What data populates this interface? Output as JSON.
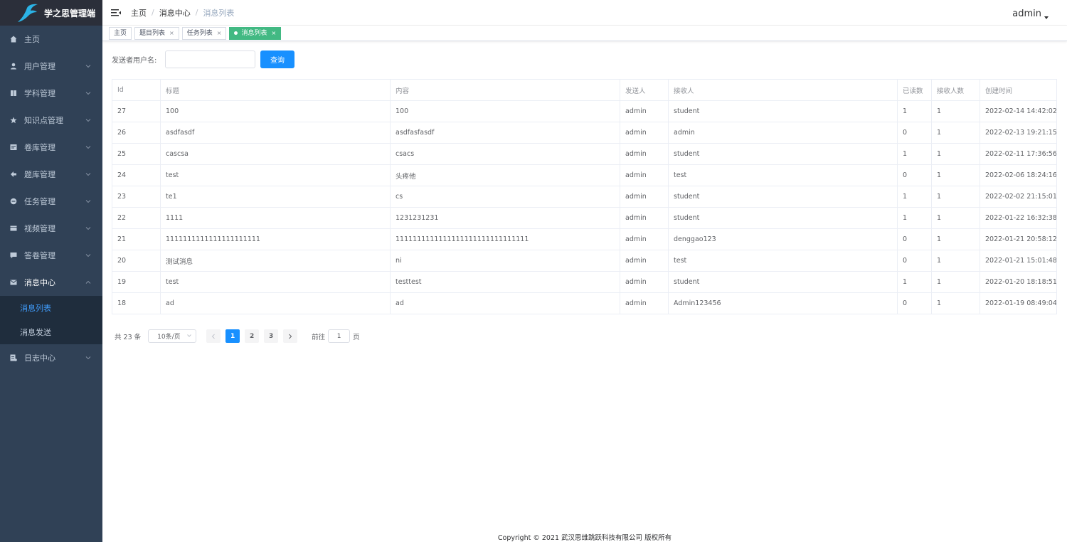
{
  "app": {
    "title": "学之思管理端"
  },
  "sidebar": {
    "items": [
      {
        "label": "主页",
        "icon": "home-icon",
        "expandable": false
      },
      {
        "label": "用户管理",
        "icon": "user-icon",
        "expandable": true
      },
      {
        "label": "学科管理",
        "icon": "book-icon",
        "expandable": true
      },
      {
        "label": "知识点管理",
        "icon": "star-icon",
        "expandable": true
      },
      {
        "label": "卷库管理",
        "icon": "paper-icon",
        "expandable": true
      },
      {
        "label": "题库管理",
        "icon": "question-icon",
        "expandable": true
      },
      {
        "label": "任务管理",
        "icon": "task-icon",
        "expandable": true
      },
      {
        "label": "视频管理",
        "icon": "video-icon",
        "expandable": true
      },
      {
        "label": "答卷管理",
        "icon": "chat-icon",
        "expandable": true
      },
      {
        "label": "消息中心",
        "icon": "mail-icon",
        "expandable": true,
        "open": true
      },
      {
        "label": "日志中心",
        "icon": "log-icon",
        "expandable": true
      }
    ],
    "submenu": [
      {
        "label": "消息列表",
        "active": true
      },
      {
        "label": "消息发送",
        "active": false
      }
    ]
  },
  "header": {
    "breadcrumb": [
      "主页",
      "消息中心",
      "消息列表"
    ],
    "user": "admin"
  },
  "tags": [
    {
      "label": "主页",
      "closable": false,
      "active": false
    },
    {
      "label": "题目列表",
      "closable": true,
      "active": false
    },
    {
      "label": "任务列表",
      "closable": true,
      "active": false
    },
    {
      "label": "消息列表",
      "closable": true,
      "active": true
    }
  ],
  "filter": {
    "label": "发送者用户名:",
    "value": "",
    "button": "查询"
  },
  "table": {
    "columns": [
      "Id",
      "标题",
      "内容",
      "发送人",
      "接收人",
      "已读数",
      "接收人数",
      "创建时间"
    ],
    "rows": [
      [
        "27",
        "100",
        "100",
        "admin",
        "student",
        "1",
        "1",
        "2022-02-14 14:42:02"
      ],
      [
        "26",
        "asdfasdf",
        "asdfasfasdf",
        "admin",
        "admin",
        "0",
        "1",
        "2022-02-13 19:21:15"
      ],
      [
        "25",
        "cascsa",
        "csacs",
        "admin",
        "student",
        "1",
        "1",
        "2022-02-11 17:36:56"
      ],
      [
        "24",
        "test",
        "头疼他",
        "admin",
        "test",
        "0",
        "1",
        "2022-02-06 18:24:16"
      ],
      [
        "23",
        "te1",
        "cs",
        "admin",
        "student",
        "1",
        "1",
        "2022-02-02 21:15:01"
      ],
      [
        "22",
        "1111",
        "1231231231",
        "admin",
        "student",
        "1",
        "1",
        "2022-01-22 16:32:38"
      ],
      [
        "21",
        "1111111111111111111111",
        "1111111111111111111111111111111",
        "admin",
        "denggao123",
        "0",
        "1",
        "2022-01-21 20:58:12"
      ],
      [
        "20",
        "测试消息",
        "ni",
        "admin",
        "test",
        "0",
        "1",
        "2022-01-21 15:01:48"
      ],
      [
        "19",
        "test",
        "testtest",
        "admin",
        "student",
        "1",
        "1",
        "2022-01-20 18:18:51"
      ],
      [
        "18",
        "ad",
        "ad",
        "admin",
        "Admin123456",
        "0",
        "1",
        "2022-01-19 08:49:04"
      ]
    ]
  },
  "pagination": {
    "total": "共 23 条",
    "page_size": "10条/页",
    "pages": [
      "1",
      "2",
      "3"
    ],
    "current": "1",
    "goto_label": "前往",
    "goto_value": "1",
    "goto_suffix": "页"
  },
  "footer": {
    "text": "Copyright © 2021 武汉思维跳跃科技有限公司 版权所有"
  },
  "colors": {
    "sidebar": "#304156",
    "primary": "#1890ff",
    "tag_active": "#42b983"
  }
}
